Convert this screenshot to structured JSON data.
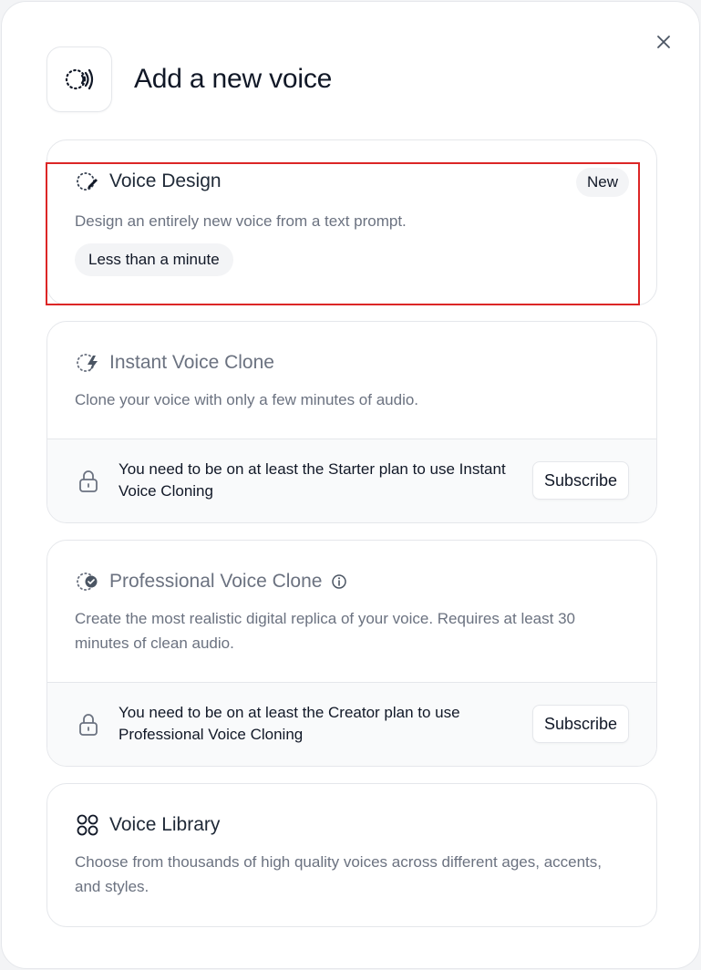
{
  "dialog": {
    "title": "Add a new voice",
    "close_icon": "close-icon",
    "header_icon": "voice-waves-icon"
  },
  "options": {
    "voice_design": {
      "icon": "voice-design-icon",
      "title": "Voice Design",
      "badge": "New",
      "description": "Design an entirely new voice from a text prompt.",
      "duration": "Less than a minute"
    },
    "instant_clone": {
      "icon": "instant-clone-icon",
      "title": "Instant Voice Clone",
      "description": "Clone your voice with only a few minutes of audio.",
      "lock_text": "You need to be on at least the Starter plan to use Instant Voice Cloning",
      "subscribe_label": "Subscribe"
    },
    "professional_clone": {
      "icon": "professional-clone-icon",
      "title": "Professional Voice Clone",
      "info_icon": "info-icon",
      "description": "Create the most realistic digital replica of your voice. Requires at least 30 minutes of clean audio.",
      "lock_text": "You need to be on at least the Creator plan to use Professional Voice Cloning",
      "subscribe_label": "Subscribe"
    },
    "voice_library": {
      "icon": "library-grid-icon",
      "title": "Voice Library",
      "description": "Choose from thousands of high quality voices across different ages, accents, and styles."
    }
  },
  "highlight_color": "#dc2626"
}
